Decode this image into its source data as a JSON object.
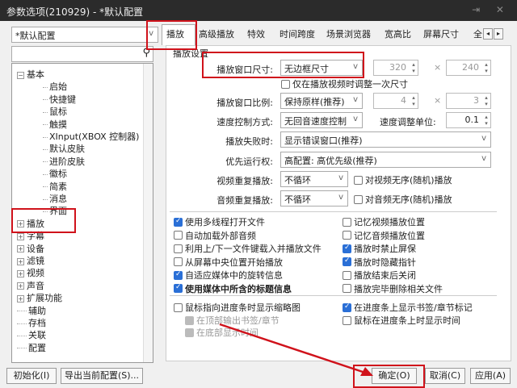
{
  "window": {
    "title": "参数选项(210929) - *默认配置",
    "controls": "⇥ ✕"
  },
  "profile": {
    "value": "*默认配置"
  },
  "search": {
    "placeholder": ""
  },
  "tabs": [
    "播放",
    "高级播放",
    "特效",
    "时间跨度",
    "场景浏览器",
    "宽高比",
    "屏幕尺寸",
    "全"
  ],
  "tree": [
    {
      "label": "基本",
      "level": 0,
      "exp": "⊟"
    },
    {
      "label": "启始",
      "level": 1
    },
    {
      "label": "快捷键",
      "level": 1
    },
    {
      "label": "鼠标",
      "level": 1
    },
    {
      "label": "触摸",
      "level": 1
    },
    {
      "label": "XInput(XBOX 控制器)",
      "level": 1
    },
    {
      "label": "默认皮肤",
      "level": 1
    },
    {
      "label": "进阶皮肤",
      "level": 1
    },
    {
      "label": "徽标",
      "level": 1
    },
    {
      "label": "简素",
      "level": 1
    },
    {
      "label": "消息",
      "level": 1
    },
    {
      "label": "界面",
      "level": 1
    },
    {
      "label": "播放",
      "level": 0,
      "exp": "⊞"
    },
    {
      "label": "字幕",
      "level": 0,
      "exp": "⊞"
    },
    {
      "label": "设备",
      "level": 0,
      "exp": "⊞"
    },
    {
      "label": "滤镜",
      "level": 0,
      "exp": "⊞"
    },
    {
      "label": "视频",
      "level": 0,
      "exp": "⊞"
    },
    {
      "label": "声音",
      "level": 0,
      "exp": "⊞"
    },
    {
      "label": "扩展功能",
      "level": 0,
      "exp": "⊞"
    },
    {
      "label": "辅助",
      "level": 0
    },
    {
      "label": "存档",
      "level": 0
    },
    {
      "label": "关联",
      "level": 0
    },
    {
      "label": "配置",
      "level": 0
    }
  ],
  "group_title": "播放设置",
  "settings": {
    "window_size": {
      "label": "播放窗口尺寸:",
      "value": "无边框尺寸",
      "w": "320",
      "h": "240",
      "x": "×"
    },
    "resize_once": {
      "label": "仅在播放视频时调整一次尺寸",
      "checked": false
    },
    "ratio": {
      "label": "播放窗口比例:",
      "value": "保持原样(推荐)",
      "a": "4",
      "b": "3",
      "x": "×"
    },
    "speed": {
      "label": "速度控制方式:",
      "value": "无回音速度控制",
      "unit_label": "速度调整单位:",
      "unit": "0.1"
    },
    "fail": {
      "label": "播放失败时:",
      "value": "显示错误窗口(推荐)"
    },
    "priority": {
      "label": "优先运行权:",
      "value": "高配置: 高优先级(推荐)"
    },
    "video_repeat": {
      "label": "视频重复播放:",
      "value": "不循环",
      "random": "对视频无序(随机)播放"
    },
    "audio_repeat": {
      "label": "音频重复播放:",
      "value": "不循环",
      "random": "对音频无序(随机)播放"
    }
  },
  "checks_left": [
    {
      "label": "使用多线程打开文件",
      "checked": true
    },
    {
      "label": "自动加载外部音频",
      "checked": false
    },
    {
      "label": "利用上/下一文件键载入并播放文件",
      "checked": false
    },
    {
      "label": "从屏幕中央位置开始播放",
      "checked": false
    },
    {
      "label": "自适应媒体中的旋转信息",
      "checked": true
    },
    {
      "label": "使用媒体中所含的标题信息",
      "checked": true
    }
  ],
  "checks_right": [
    {
      "label": "记忆视频播放位置",
      "checked": false
    },
    {
      "label": "记忆音频播放位置",
      "checked": false
    },
    {
      "label": "播放时禁止屏保",
      "checked": true
    },
    {
      "label": "播放时隐藏指针",
      "checked": true
    },
    {
      "label": "播放结束后关闭",
      "checked": false
    },
    {
      "label": "播放完毕删除相关文件",
      "checked": false
    }
  ],
  "seek": {
    "thumb": "鼠标指向进度条时显示缩略图",
    "top": "在顶部输出书签/章节",
    "bottom": "在底部显示时间",
    "marks": "在进度条上显示书签/章节标记",
    "time": "鼠标在进度条上时显示时间"
  },
  "buttons": {
    "init": "初始化(I)",
    "export": "导出当前配置(S)...",
    "ok": "确定(O)",
    "cancel": "取消(C)",
    "apply": "应用(A)"
  },
  "accent": "#d0121b"
}
